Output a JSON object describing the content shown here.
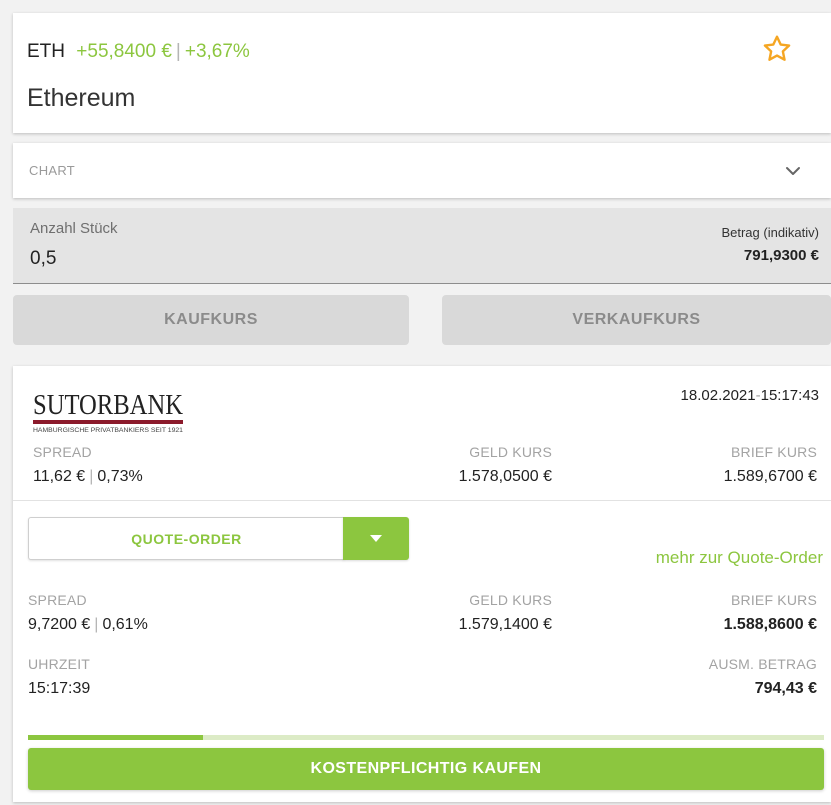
{
  "header": {
    "symbol": "ETH",
    "change_abs": "+55,8400 €",
    "change_sep": "|",
    "change_pct": "+3,67%",
    "name": "Ethereum",
    "favorite_icon": "star-outline-icon",
    "accent_color": "#8cc63f",
    "star_color": "#f5a623"
  },
  "chart": {
    "label": "CHART",
    "toggle_icon": "chevron-down-icon"
  },
  "amount": {
    "label": "Anzahl Stück",
    "value": "0,5",
    "betrag_label": "Betrag (indikativ)",
    "betrag_value": "791,9300 €"
  },
  "tabs": {
    "buy_label": "KAUFKURS",
    "sell_label": "VERKAUFKURS"
  },
  "bank": {
    "logo_name": "SUTORBANK",
    "logo_subtitle": "HAMBURGISCHE PRIVATBANKIERS SEIT 1921",
    "timestamp_date": "18.02.2021",
    "timestamp_sep": "-",
    "timestamp_time": "15:17:43",
    "spread_label": "SPREAD",
    "spread_abs": "11,62 €",
    "spread_pct": "0,73%",
    "geld_label": "GELD KURS",
    "geld_value": "1.578,0500 €",
    "brief_label": "BRIEF KURS",
    "brief_value": "1.589,6700 €"
  },
  "quote_order": {
    "select_label": "QUOTE-ORDER",
    "dropdown_icon": "caret-down-icon",
    "more_link": "mehr zur Quote-Order",
    "spread_label": "SPREAD",
    "spread_abs": "9,7200 €",
    "spread_pct": "0,61%",
    "geld_label": "GELD KURS",
    "geld_value": "1.579,1400 €",
    "brief_label": "BRIEF KURS",
    "brief_value": "1.588,8600 €",
    "time_label": "UHRZEIT",
    "time_value": "15:17:39",
    "ausm_label": "AUSM. BETRAG",
    "ausm_value": "794,43 €",
    "progress_fraction": 0.22,
    "buy_button": "KOSTENPFLICHTIG KAUFEN"
  }
}
